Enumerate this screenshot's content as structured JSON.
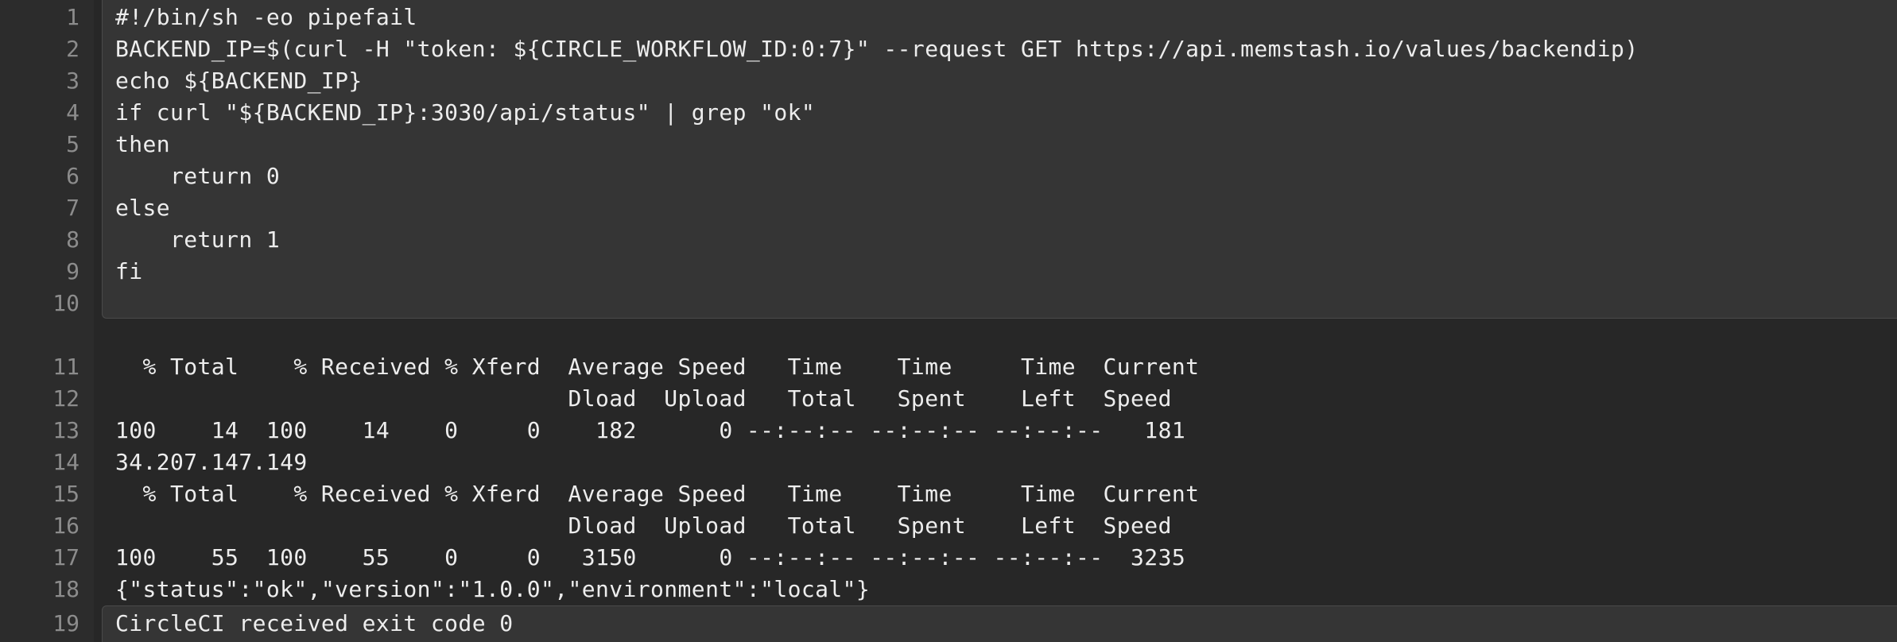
{
  "script": {
    "lines": [
      {
        "n": "1",
        "text": "#!/bin/sh -eo pipefail"
      },
      {
        "n": "2",
        "text": "BACKEND_IP=$(curl -H \"token: ${CIRCLE_WORKFLOW_ID:0:7}\" --request GET https://api.memstash.io/values/backendip)"
      },
      {
        "n": "3",
        "text": "echo ${BACKEND_IP}"
      },
      {
        "n": "4",
        "text": "if curl \"${BACKEND_IP}:3030/api/status\" | grep \"ok\""
      },
      {
        "n": "5",
        "text": "then"
      },
      {
        "n": "6",
        "text": "    return 0"
      },
      {
        "n": "7",
        "text": "else"
      },
      {
        "n": "8",
        "text": "    return 1"
      },
      {
        "n": "9",
        "text": "fi"
      },
      {
        "n": "10",
        "text": ""
      }
    ]
  },
  "output": {
    "lines": [
      {
        "n": "11",
        "text": "  % Total    % Received % Xferd  Average Speed   Time    Time     Time  Current"
      },
      {
        "n": "12",
        "text": "                                 Dload  Upload   Total   Spent    Left  Speed"
      },
      {
        "n": "13",
        "text": "100    14  100    14    0     0    182      0 --:--:-- --:--:-- --:--:--   181"
      },
      {
        "n": "14",
        "text": "34.207.147.149"
      },
      {
        "n": "15",
        "text": "  % Total    % Received % Xferd  Average Speed   Time    Time     Time  Current"
      },
      {
        "n": "16",
        "text": "                                 Dload  Upload   Total   Spent    Left  Speed"
      },
      {
        "n": "17",
        "text": "100    55  100    55    0     0   3150      0 --:--:-- --:--:-- --:--:--  3235"
      },
      {
        "n": "18",
        "text": "{\"status\":\"ok\",\"version\":\"1.0.0\",\"environment\":\"local\"}"
      }
    ]
  },
  "exit": {
    "n": "19",
    "text": "CircleCI received exit code 0"
  }
}
